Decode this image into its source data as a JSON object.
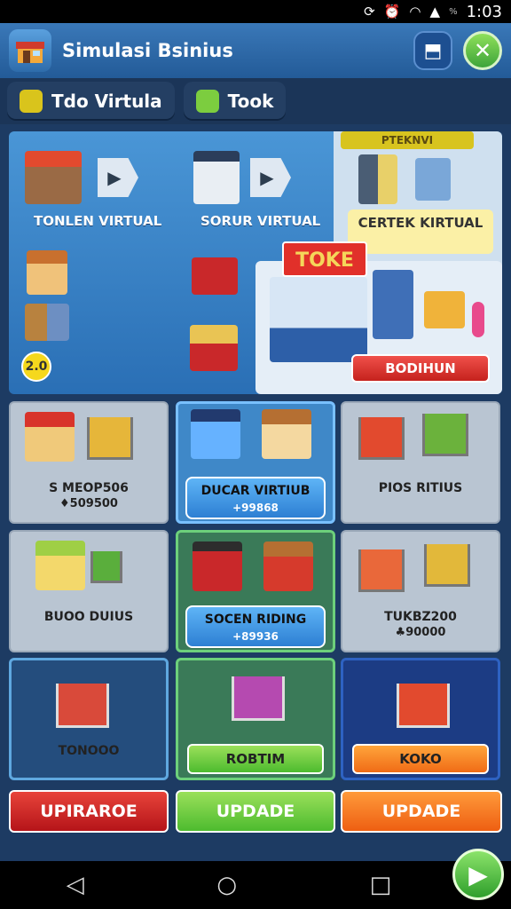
{
  "status_bar": {
    "time": "1:03",
    "battery_text": "%"
  },
  "app": {
    "title": "Simulasi Bsinius",
    "close_glyph": "✕",
    "action_glyph": "⬒"
  },
  "tabs": [
    {
      "label": "Tdo Virtula",
      "icon": "pin-icon",
      "color": "#d9c41c"
    },
    {
      "label": "Took",
      "icon": "box-icon",
      "color": "#7ccd3f"
    }
  ],
  "banner": {
    "item1": "TONLEN VIRTUAL",
    "item2": "SORUR VIRTUAL",
    "promo_chip": "PTEKNVI",
    "certek": "CERTEK KIRTUAL",
    "sign": "TOKE",
    "button": "BODIHUN",
    "badge": "2.0"
  },
  "cards": [
    {
      "label": "S MEOP506",
      "sub": "♦509500"
    },
    {
      "label": "DUCAR VIRTIUB",
      "sub": "+99868"
    },
    {
      "label": "PIOS RITIUS",
      "sub": ""
    },
    {
      "label": "BUOO DUIUS",
      "sub": ""
    },
    {
      "label": "SOCEN RIDING",
      "sub": "+89936"
    },
    {
      "label": "TUKBZ200",
      "sub": "♣90000"
    },
    {
      "label": "TONOOO",
      "sub": ""
    },
    {
      "label": "ROBTIM",
      "sub": ""
    },
    {
      "label": "KOKO",
      "sub": ""
    }
  ],
  "updates": [
    {
      "label": "UPIRAROE",
      "color": "#d21f23"
    },
    {
      "label": "UPDADE",
      "color": "#6cc33a"
    },
    {
      "label": "UPDADE",
      "color": "#f06b16"
    }
  ],
  "navbar": {
    "back": "◁",
    "home": "○",
    "recents": "□",
    "fab": "▶"
  }
}
